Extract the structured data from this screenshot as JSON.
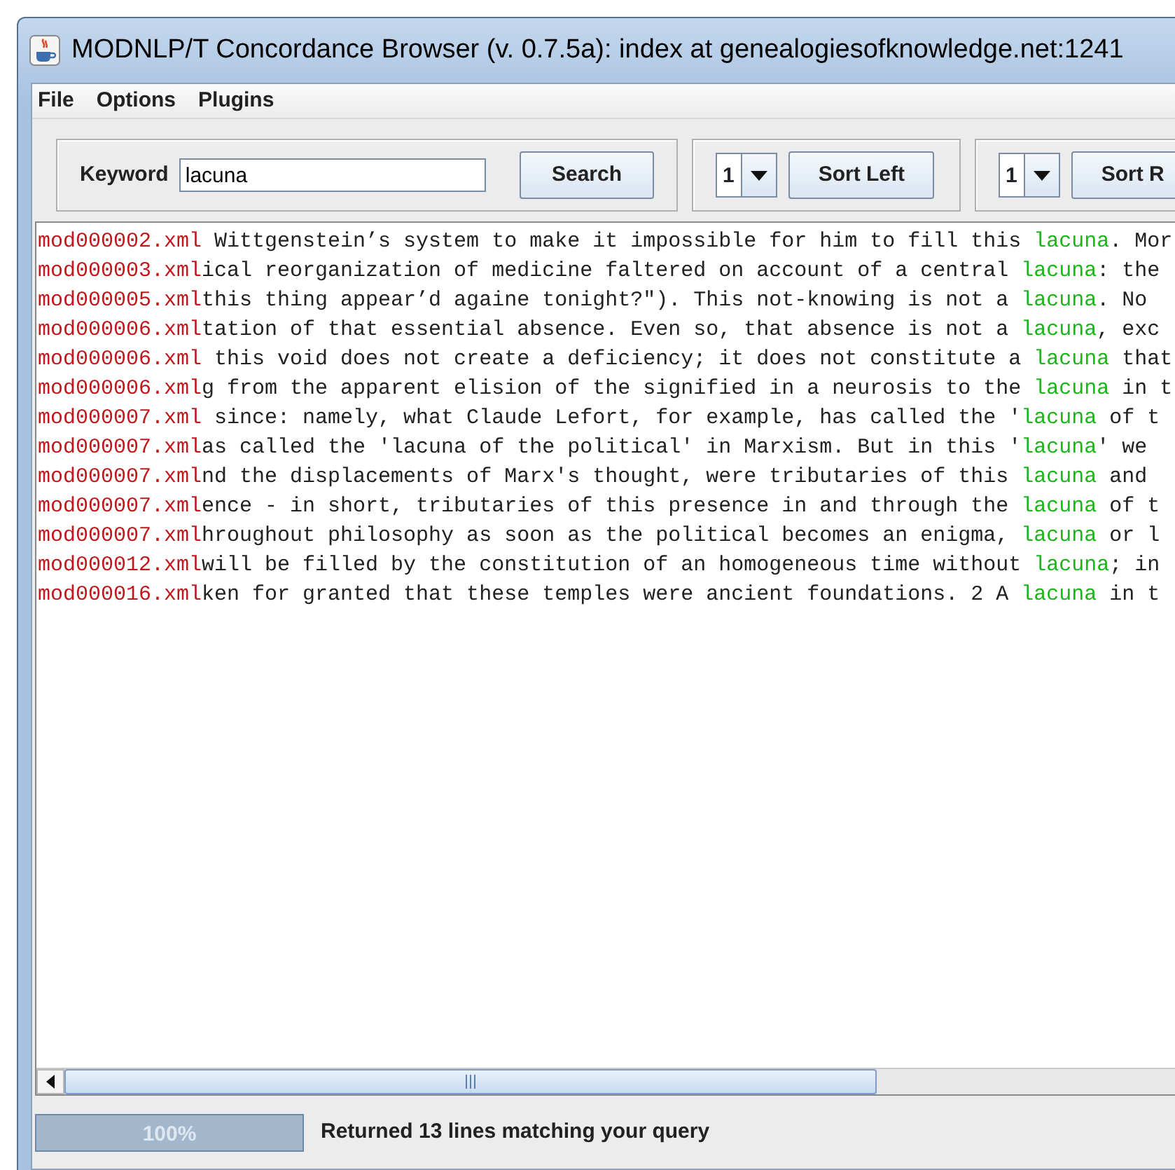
{
  "window": {
    "title": "MODNLP/T Concordance Browser (v. 0.7.5a): index at genealogiesofknowledge.net:1241"
  },
  "menu": [
    "File",
    "Options",
    "Plugins"
  ],
  "search": {
    "label": "Keyword",
    "value": "lacuna",
    "button": "Search"
  },
  "sort_panels": [
    {
      "value": "1",
      "button": "Sort Left"
    },
    {
      "value": "1",
      "button": "Sort R"
    }
  ],
  "results": [
    {
      "file": "mod000002.xml",
      "left": " Wittgenstein’s system to make it impossible for him to fill this ",
      "keyword": "lacuna",
      "right": ". Mor"
    },
    {
      "file": "mod000003.xml",
      "left": "ical reorganization of medicine faltered on account of a central ",
      "keyword": "lacuna",
      "right": ": the"
    },
    {
      "file": "mod000005.xml",
      "left": "this thing appear’d againe tonight?″). This not-knowing is not a ",
      "keyword": "lacuna",
      "right": ". No"
    },
    {
      "file": "mod000006.xml",
      "left": "tation of that essential absence. Even so, that absence is not a ",
      "keyword": "lacuna",
      "right": ", exc"
    },
    {
      "file": "mod000006.xml",
      "left": " this void does not create a deficiency; it does not constitute a ",
      "keyword": "lacuna",
      "right": " that"
    },
    {
      "file": "mod000006.xml",
      "left": "g from the apparent elision of the signified in a neurosis to the ",
      "keyword": "lacuna",
      "right": " in t"
    },
    {
      "file": "mod000007.xml",
      "left": " since: namely, what Claude Lefort, for example, has called the '",
      "keyword": "lacuna",
      "right": " of t"
    },
    {
      "file": "mod000007.xml",
      "left": "as called the 'lacuna of the political' in Marxism. But in this '",
      "keyword": "lacuna",
      "right": "' we"
    },
    {
      "file": "mod000007.xml",
      "left": "nd the displacements of Marx's thought, were tributaries of this ",
      "keyword": "lacuna",
      "right": " and"
    },
    {
      "file": "mod000007.xml",
      "left": "ence - in short, tributaries of this presence in and through the ",
      "keyword": "lacuna",
      "right": " of t"
    },
    {
      "file": "mod000007.xml",
      "left": "hroughout philosophy as soon as the political becomes an enigma, ",
      "keyword": "lacuna",
      "right": " or l"
    },
    {
      "file": "mod000012.xml",
      "left": "will be filled by the constitution of an homogeneous time without ",
      "keyword": "lacuna",
      "right": "; in"
    },
    {
      "file": "mod000016.xml",
      "left": "ken for granted that these temples were ancient foundations. 2 A ",
      "keyword": "lacuna",
      "right": " in t"
    }
  ],
  "progress": {
    "level": 1,
    "label": "100%"
  },
  "status": "Returned 13 lines matching your query"
}
